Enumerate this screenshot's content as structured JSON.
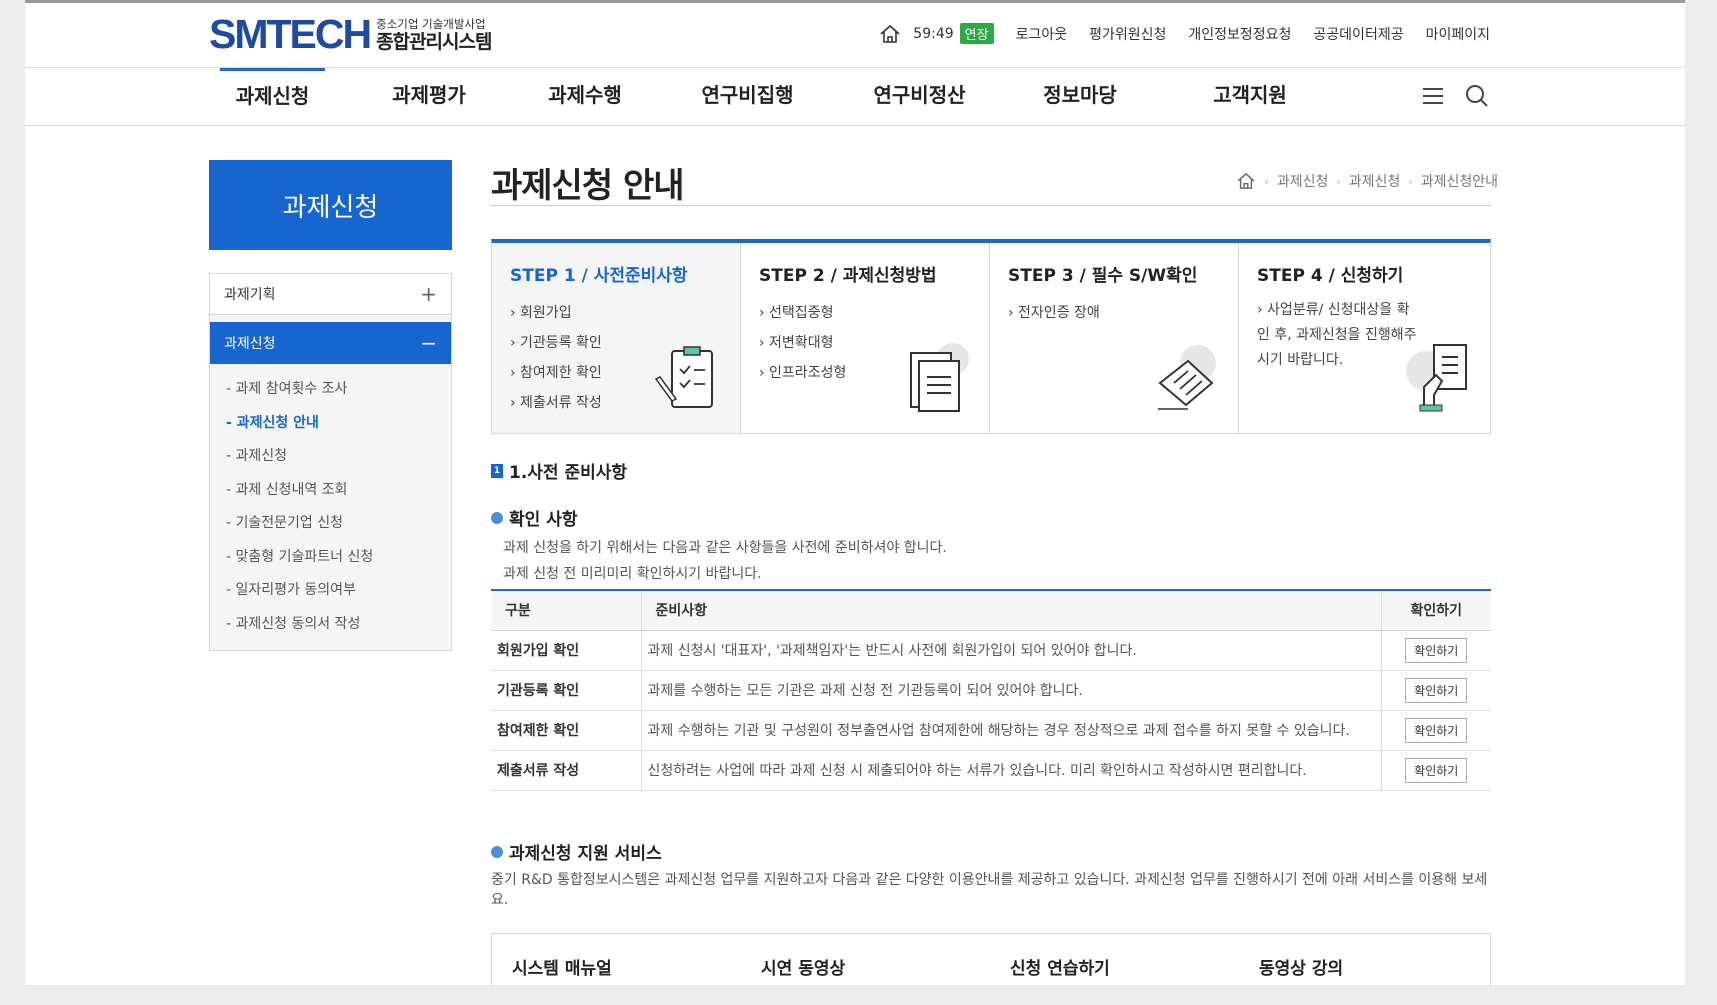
{
  "header": {
    "logo_main": "SMTECH",
    "logo_sub1": "중소기업 기술개발사업",
    "logo_sub2": "종합관리시스템",
    "timer": "59:49",
    "extend_label": "연장",
    "util_links": [
      "로그아웃",
      "평가위원신청",
      "개인정보정정요청",
      "공공데이터제공",
      "마이페이지"
    ]
  },
  "gnb": {
    "items": [
      "과제신청",
      "과제평가",
      "과제수행",
      "연구비집행",
      "연구비정산",
      "정보마당",
      "고객지원"
    ],
    "active_index": 0
  },
  "lnb": {
    "title": "과제신청",
    "group1": {
      "label": "과제기획",
      "toggle": "+"
    },
    "group2": {
      "label": "과제신청",
      "toggle": "−"
    },
    "subitems": [
      "- 과제 참여횟수 조사",
      "- 과제신청 안내",
      "- 과제신청",
      "- 과제 신청내역 조회",
      "- 기술전문기업 신청",
      "- 맞춤형 기술파트너 신청",
      "- 일자리평가 동의여부",
      "- 과제신청 동의서 작성"
    ],
    "active_sub": 1
  },
  "page": {
    "title": "과제신청 안내",
    "breadcrumb": [
      "과제신청",
      "과제신청",
      "과제신청안내"
    ]
  },
  "steps": [
    {
      "title": "STEP 1 / 사전준비사항",
      "items": [
        "› 회원가입",
        "› 기관등록 확인",
        "› 참여제한 확인",
        "› 제출서류 작성"
      ],
      "icon": "clipboard-pen-icon"
    },
    {
      "title": "STEP 2 / 과제신청방법",
      "items": [
        "› 선택집중형",
        "› 저변확대형",
        "› 인프라조성형"
      ],
      "icon": "documents-icon"
    },
    {
      "title": "STEP 3 / 필수 S/W확인",
      "items": [
        "› 전자인증 장애"
      ],
      "icon": "certificate-icon"
    },
    {
      "title": "STEP 4 / 신청하기",
      "desc": "› 사업분류/ 신청대상을 확인 후, 과제신청을 진행해주시기 바랍니다.",
      "icon": "hand-document-icon"
    }
  ],
  "section1": {
    "badge": "1",
    "title": "1.사전 준비사항",
    "sub_title": "확인 사항",
    "para_line1": "과제 신청을 하기 위해서는 다음과 같은 사항들을 사전에 준비하셔야 합니다.",
    "para_line2": "과제 신청 전 미리미리 확인하시기 바랍니다.",
    "table": {
      "headers": [
        "구분",
        "준비사항",
        "확인하기"
      ],
      "rows": [
        {
          "k": "회원가입 확인",
          "v": "과제 신청시 '대표자', '과제책임자'는 반드시 사전에 회원가입이 되어 있어야 합니다.",
          "btn": "확인하기"
        },
        {
          "k": "기관등록 확인",
          "v": "과제를 수행하는 모든 기관은 과제 신청 전 기관등록이 되어 있어야 합니다.",
          "btn": "확인하기"
        },
        {
          "k": "참여제한 확인",
          "v": "과제 수행하는 기관 및 구성원이 정부출연사업 참여제한에 해당하는 경우 정상적으로 과제 접수를 하지 못할 수 있습니다.",
          "btn": "확인하기"
        },
        {
          "k": "제출서류 작성",
          "v": "신청하려는 사업에 따라 과제 신청 시 제출되어야 하는 서류가 있습니다. 미리 확인하시고 작성하시면 편리합니다.",
          "btn": "확인하기"
        }
      ]
    }
  },
  "section2": {
    "title": "과제신청 지원 서비스",
    "para": "중기 R&D 통합정보시스템은 과제신청 업무를 지원하고자 다음과 같은 다양한 이용안내를 제공하고 있습니다. 과제신청 업무를 진행하시기 전에 아래 서비스를 이용해 보세요.",
    "services": [
      "시스템 매뉴얼",
      "시연 동영상",
      "신청 연습하기",
      "동영상 강의"
    ]
  }
}
